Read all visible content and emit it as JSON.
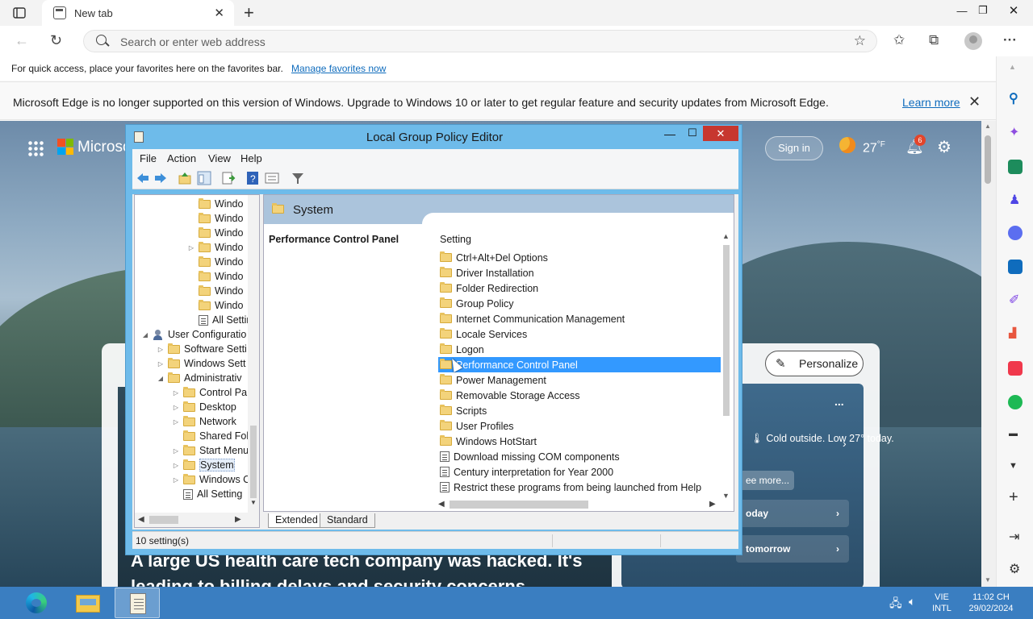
{
  "browser": {
    "tab_title": "New tab",
    "address_placeholder": "Search or enter web address",
    "favorites_bar_text": "For quick access, place your favorites here on the favorites bar.",
    "favorites_bar_link": "Manage favorites now",
    "infobar_text": "Microsoft Edge is no longer supported on this version of Windows. Upgrade to Windows 10 or later to get regular feature and security updates from Microsoft Edge.",
    "infobar_link": "Learn more"
  },
  "newtab_page": {
    "brand": "Microso",
    "signin": "Sign in",
    "temperature": "27",
    "temperature_unit": "°F",
    "notification_count": "6",
    "personalize": "Personalize",
    "weather_text": "Cold outside. Low 27° today.",
    "see_more": "ee more...",
    "row_today": "oday",
    "row_tomorrow": "tomorrow",
    "news_headline": "A large US health care tech company was hacked. It's leading to billing delays and security concerns",
    "menu_dots": "..."
  },
  "gpe": {
    "title": "Local Group Policy Editor",
    "menu": [
      "File",
      "Action",
      "View",
      "Help"
    ],
    "tree": [
      {
        "label": "Windo",
        "indent": 3,
        "expander": "",
        "icon": "folder"
      },
      {
        "label": "Windo",
        "indent": 3,
        "expander": "",
        "icon": "folder"
      },
      {
        "label": "Windo",
        "indent": 3,
        "expander": "",
        "icon": "folder"
      },
      {
        "label": "Windo",
        "indent": 3,
        "expander": "▷",
        "icon": "folder"
      },
      {
        "label": "Windo",
        "indent": 3,
        "expander": "",
        "icon": "folder"
      },
      {
        "label": "Windo",
        "indent": 3,
        "expander": "",
        "icon": "folder"
      },
      {
        "label": "Windo",
        "indent": 3,
        "expander": "",
        "icon": "folder"
      },
      {
        "label": "Windo",
        "indent": 3,
        "expander": "",
        "icon": "folder"
      },
      {
        "label": "All Setting",
        "indent": 3,
        "expander": "",
        "icon": "policy"
      },
      {
        "label": "User Configuratio",
        "indent": 0,
        "expander": "◢",
        "icon": "user"
      },
      {
        "label": "Software Setti",
        "indent": 1,
        "expander": "▷",
        "icon": "folder"
      },
      {
        "label": "Windows Sett",
        "indent": 1,
        "expander": "▷",
        "icon": "folder"
      },
      {
        "label": "Administrativ",
        "indent": 1,
        "expander": "◢",
        "icon": "folder"
      },
      {
        "label": "Control Pa",
        "indent": 2,
        "expander": "▷",
        "icon": "folder"
      },
      {
        "label": "Desktop",
        "indent": 2,
        "expander": "▷",
        "icon": "folder"
      },
      {
        "label": "Network",
        "indent": 2,
        "expander": "▷",
        "icon": "folder"
      },
      {
        "label": "Shared Fol",
        "indent": 2,
        "expander": "",
        "icon": "folder"
      },
      {
        "label": "Start Menu",
        "indent": 2,
        "expander": "▷",
        "icon": "folder"
      },
      {
        "label": "System",
        "indent": 2,
        "expander": "▷",
        "icon": "folder",
        "selected": true
      },
      {
        "label": "Windows C",
        "indent": 2,
        "expander": "▷",
        "icon": "folder"
      },
      {
        "label": "All Setting",
        "indent": 2,
        "expander": "",
        "icon": "policy"
      }
    ],
    "header_title": "System",
    "description_title": "Performance Control Panel",
    "column_header": "Setting",
    "settings": [
      {
        "label": "Ctrl+Alt+Del Options",
        "icon": "folder"
      },
      {
        "label": "Driver Installation",
        "icon": "folder"
      },
      {
        "label": "Folder Redirection",
        "icon": "folder"
      },
      {
        "label": "Group Policy",
        "icon": "folder"
      },
      {
        "label": "Internet Communication Management",
        "icon": "folder"
      },
      {
        "label": "Locale Services",
        "icon": "folder"
      },
      {
        "label": "Logon",
        "icon": "folder"
      },
      {
        "label": "Performance Control Panel",
        "icon": "folder",
        "selected": true
      },
      {
        "label": "Power Management",
        "icon": "folder"
      },
      {
        "label": "Removable Storage Access",
        "icon": "folder"
      },
      {
        "label": "Scripts",
        "icon": "folder"
      },
      {
        "label": "User Profiles",
        "icon": "folder"
      },
      {
        "label": "Windows HotStart",
        "icon": "folder"
      },
      {
        "label": "Download missing COM components",
        "icon": "policy"
      },
      {
        "label": "Century interpretation for Year 2000",
        "icon": "policy"
      },
      {
        "label": "Restrict these programs from being launched from Help",
        "icon": "policy"
      }
    ],
    "tabs": [
      "Extended",
      "Standard"
    ],
    "status": "10 setting(s)"
  },
  "taskbar": {
    "lang_line1": "VIE",
    "lang_line2": "INTL",
    "time": "11:02 CH",
    "date": "29/02/2024"
  }
}
